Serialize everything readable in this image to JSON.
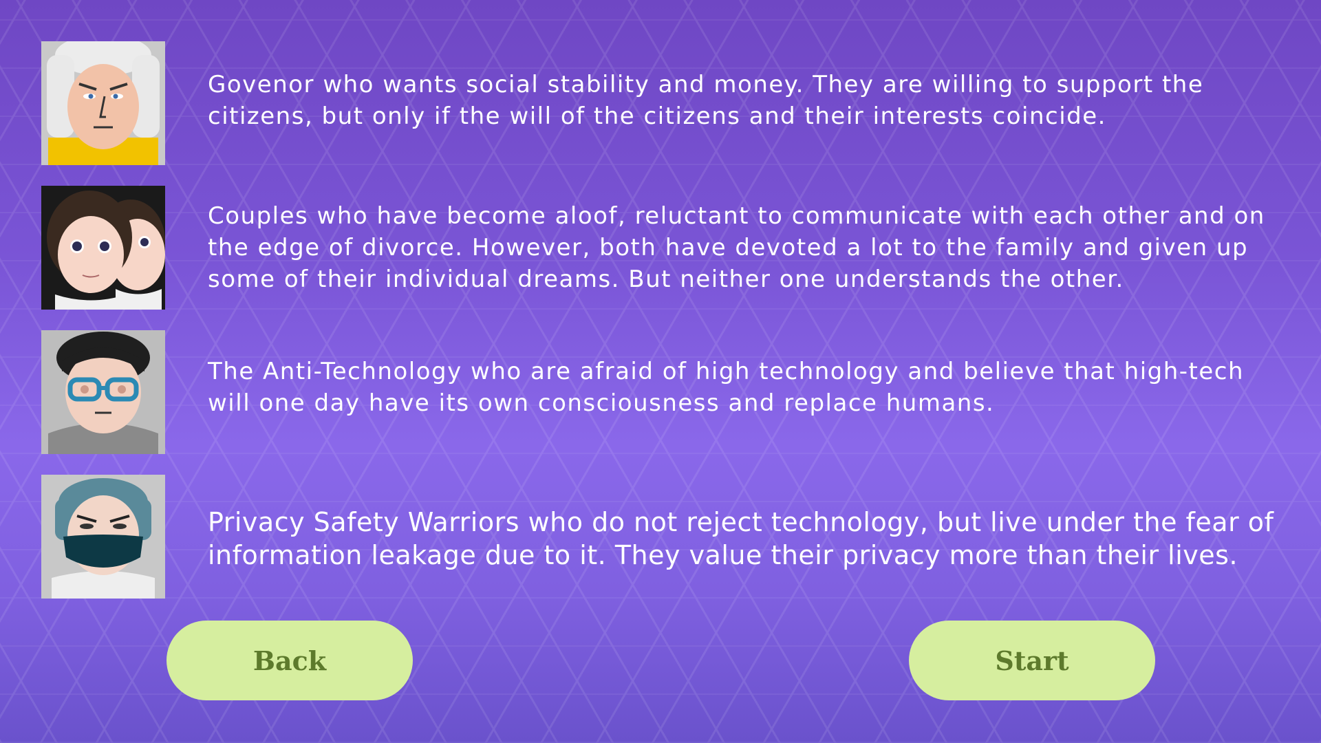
{
  "characters": [
    {
      "name_icon": "governor-portrait",
      "description": "Govenor who wants social stability and money. They are willing to support the citizens, but only if the will of the citizens and their interests coincide."
    },
    {
      "name_icon": "couple-portrait",
      "description": "Couples who have become aloof, reluctant to communicate with each other and on the edge of divorce. However, both have devoted a lot to the family and given up some of their individual dreams. But neither one understands the other."
    },
    {
      "name_icon": "anti-technology-portrait",
      "description": "The Anti-Technology who are afraid of high technology and believe that high-tech will one day have its own consciousness and replace humans."
    },
    {
      "name_icon": "privacy-warrior-portrait",
      "description": "Privacy Safety Warriors who do not reject technology, but live under the fear of information leakage due to it. They value their privacy more than their lives."
    }
  ],
  "buttons": {
    "back_label": "Back",
    "start_label": "Start"
  },
  "colors": {
    "background": "#7a55d6",
    "button_fill": "#d6ee9f",
    "button_text": "#5d7a2c"
  }
}
